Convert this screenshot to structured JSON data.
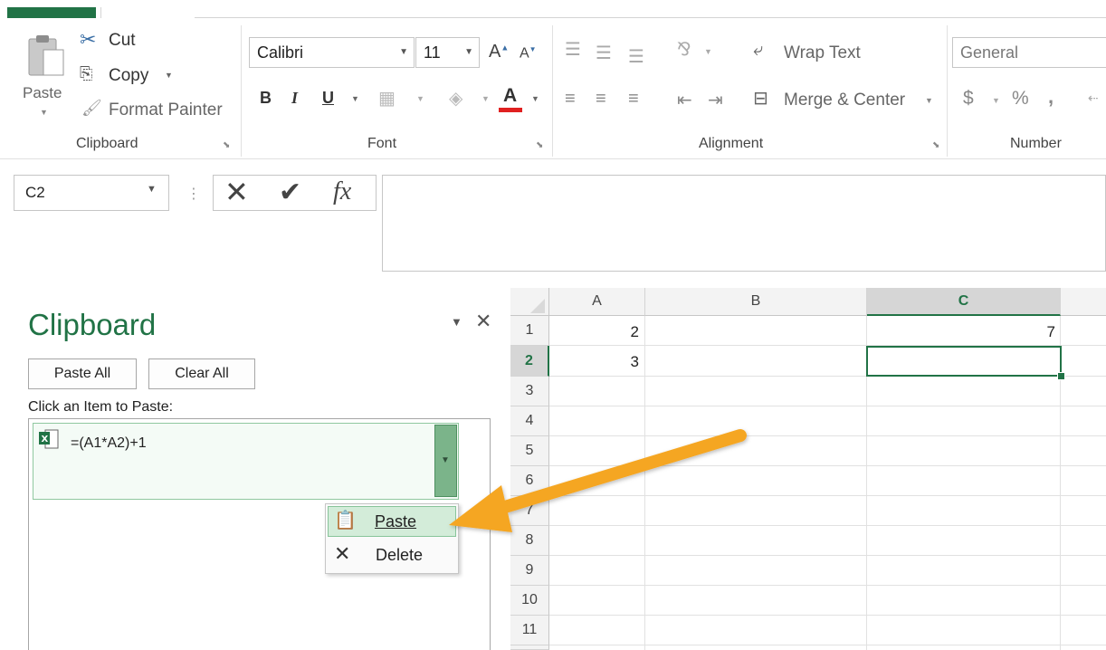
{
  "ribbon": {
    "clipboard": {
      "paste_label": "Paste",
      "cut_label": "Cut",
      "copy_label": "Copy",
      "format_painter_label": "Format Painter",
      "group_label": "Clipboard"
    },
    "font": {
      "font_name": "Calibri",
      "font_size": "11",
      "bold_label": "B",
      "italic_label": "I",
      "underline_label": "U",
      "font_color_label": "A",
      "group_label": "Font"
    },
    "alignment": {
      "wrap_text_label": "Wrap Text",
      "merge_center_label": "Merge & Center",
      "group_label": "Alignment"
    },
    "number": {
      "format_value": "General",
      "currency_label": "$",
      "percent_label": "%",
      "comma_label": ",",
      "group_label": "Number"
    }
  },
  "formula_bar": {
    "name_box": "C2",
    "fx_label": "fx",
    "formula_value": ""
  },
  "clipboard_pane": {
    "title": "Clipboard",
    "paste_all_label": "Paste All",
    "clear_all_label": "Clear All",
    "hint": "Click an Item to Paste:",
    "item_text": "=(A1*A2)+1"
  },
  "context_menu": {
    "paste_label": "Paste",
    "delete_label": "Delete"
  },
  "grid": {
    "columns": [
      "A",
      "B",
      "C"
    ],
    "rows": [
      "1",
      "2",
      "3",
      "4",
      "5",
      "6",
      "7",
      "8",
      "9",
      "10",
      "11"
    ],
    "cells": {
      "A1": "2",
      "A2": "3",
      "C1": "7"
    },
    "selected_cell": "C2"
  },
  "colors": {
    "accent": "#217346",
    "arrow": "#f5a623"
  },
  "icons": {
    "cut": "scissors-icon",
    "copy": "copy-icon",
    "format_painter": "brush-icon",
    "paste": "clipboard-icon",
    "cancel": "x-icon",
    "enter": "check-icon",
    "excel_item": "excel-file-icon"
  }
}
